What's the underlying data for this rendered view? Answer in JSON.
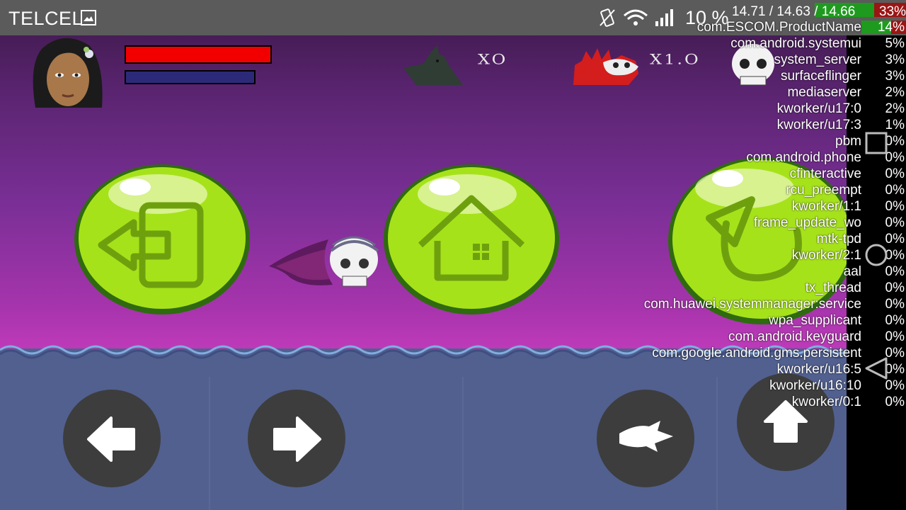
{
  "status_bar": {
    "carrier": "TELCEL",
    "battery_text": "10 %",
    "icons": [
      "gallery-icon",
      "vibrate-icon",
      "wifi-icon",
      "signal-icon"
    ]
  },
  "hud": {
    "health_fraction": 1.0,
    "mana_fraction": 0.89,
    "enemies": [
      {
        "icon": "jackal-enemy-icon",
        "count": "XO"
      },
      {
        "icon": "red-chupacabra-enemy-icon",
        "count": "X1.O"
      },
      {
        "icon": "skull-enemy-icon",
        "count": ""
      }
    ]
  },
  "menu_buttons": [
    {
      "name": "exit-button",
      "icon": "exit-door-icon"
    },
    {
      "name": "home-button",
      "icon": "home-icon"
    },
    {
      "name": "restart-button",
      "icon": "restart-icon"
    }
  ],
  "controls": [
    {
      "name": "move-left-button",
      "icon": "arrow-left-icon"
    },
    {
      "name": "move-right-button",
      "icon": "arrow-right-icon"
    },
    {
      "name": "dash-button",
      "icon": "dash-icon"
    },
    {
      "name": "jump-button",
      "icon": "arrow-up-icon"
    }
  ],
  "perf_overlay": {
    "load": "14.71 / 14.63 / 14.66",
    "cpu_total": "33%",
    "processes": [
      {
        "name": "com.ESCOM.ProductName",
        "pct": "14%"
      },
      {
        "name": "com.android.systemui",
        "pct": "5%"
      },
      {
        "name": "system_server",
        "pct": "3%"
      },
      {
        "name": "surfaceflinger",
        "pct": "3%"
      },
      {
        "name": "mediaserver",
        "pct": "2%"
      },
      {
        "name": "kworker/u17:0",
        "pct": "2%"
      },
      {
        "name": "kworker/u17:3",
        "pct": "1%"
      },
      {
        "name": "pbm",
        "pct": "0%"
      },
      {
        "name": "com.android.phone",
        "pct": "0%"
      },
      {
        "name": "cfinteractive",
        "pct": "0%"
      },
      {
        "name": "rcu_preempt",
        "pct": "0%"
      },
      {
        "name": "kworker/1:1",
        "pct": "0%"
      },
      {
        "name": "frame_update_wo",
        "pct": "0%"
      },
      {
        "name": "mtk-tpd",
        "pct": "0%"
      },
      {
        "name": "kworker/2:1",
        "pct": "0%"
      },
      {
        "name": "aal",
        "pct": "0%"
      },
      {
        "name": "tx_thread",
        "pct": "0%"
      },
      {
        "name": "com.huawei.systemmanager:service",
        "pct": "0%"
      },
      {
        "name": "wpa_supplicant",
        "pct": "0%"
      },
      {
        "name": "com.android.keyguard",
        "pct": "0%"
      },
      {
        "name": "com.google.android.gms.persistent",
        "pct": "0%"
      },
      {
        "name": "kworker/u16:5",
        "pct": "0%"
      },
      {
        "name": "kworker/u16:10",
        "pct": "0%"
      },
      {
        "name": "kworker/0:1",
        "pct": "0%"
      }
    ]
  },
  "nav_bar": [
    {
      "name": "recents-nav-button",
      "icon": "square-icon"
    },
    {
      "name": "home-nav-button",
      "icon": "circle-icon"
    },
    {
      "name": "back-nav-button",
      "icon": "triangle-back-icon"
    }
  ],
  "colors": {
    "health": "#f20000",
    "mana": "#2c2a78",
    "button_green": "#a6e21a",
    "control_bg": "#3d3d3d",
    "water": "#51608f"
  }
}
